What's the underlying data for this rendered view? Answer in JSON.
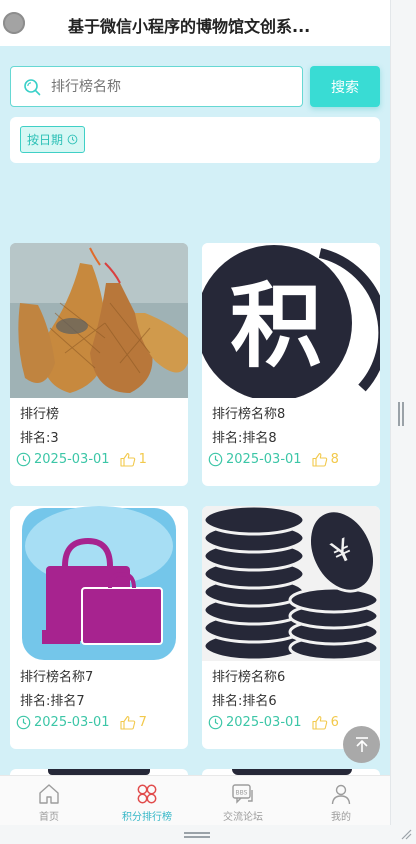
{
  "header": {
    "title": "基于微信小程序的博物馆文创系..."
  },
  "search": {
    "placeholder": "排行榜名称",
    "button_label": "搜索"
  },
  "filter": {
    "chip_label": "按日期"
  },
  "cards": [
    {
      "name": "排行榜",
      "rank": "排名:3",
      "date": "2025-03-01",
      "likes": "1",
      "image": "bamboo-craft-image"
    },
    {
      "name": "排行榜名称8",
      "rank": "排名:排名8",
      "date": "2025-03-01",
      "likes": "8",
      "image": "points-icon-image"
    },
    {
      "name": "排行榜名称7",
      "rank": "排名:排名7",
      "date": "2025-03-01",
      "likes": "7",
      "image": "shopping-bag-image"
    },
    {
      "name": "排行榜名称6",
      "rank": "排名:排名6",
      "date": "2025-03-01",
      "likes": "6",
      "image": "coins-image"
    }
  ],
  "tabbar": [
    {
      "label": "首页",
      "icon": "home-icon"
    },
    {
      "label": "积分排行榜",
      "icon": "ranking-icon",
      "active": true
    },
    {
      "label": "交流论坛",
      "icon": "forum-icon"
    },
    {
      "label": "我的",
      "icon": "profile-icon"
    }
  ],
  "colors": {
    "accent": "#39dcd4",
    "background": "#d3f0f7",
    "date": "#3cc6a7",
    "likes": "#f2c94c",
    "active_tab": "#35b7c7",
    "ranking_icon": "#e14b4b"
  }
}
